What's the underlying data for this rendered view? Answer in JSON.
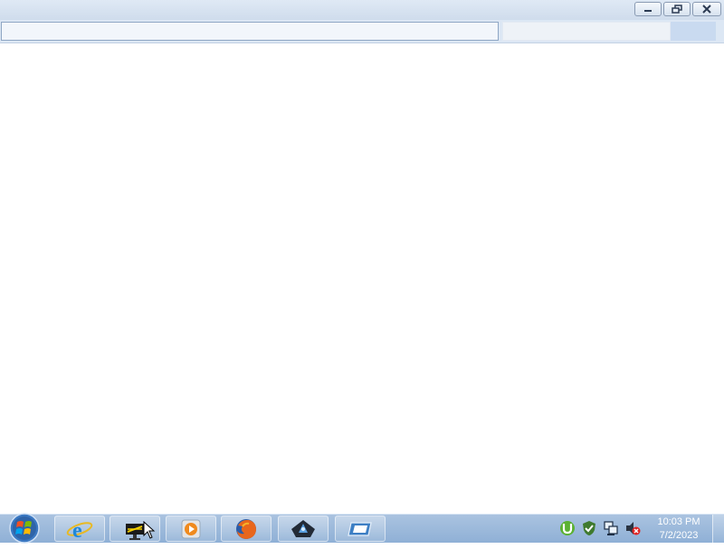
{
  "window": {
    "address_value": "",
    "search_value": ""
  },
  "taskbar": {
    "apps": [
      {
        "icon": "internet-explorer-icon"
      },
      {
        "icon": "cm-app-icon"
      },
      {
        "icon": "media-player-icon"
      },
      {
        "icon": "firefox-icon"
      },
      {
        "icon": "dark-app-icon"
      },
      {
        "icon": "window-app-icon"
      }
    ],
    "tray_icons": [
      "utorrent-icon",
      "security-shield-icon",
      "network-icon",
      "volume-muted-icon"
    ]
  },
  "clock": {
    "time": "10:03 PM",
    "date": "7/2/2023"
  },
  "colors": {
    "taskbar": "#9bb8dc",
    "titlebar": "#d7e3f1",
    "content": "#ffffff"
  }
}
